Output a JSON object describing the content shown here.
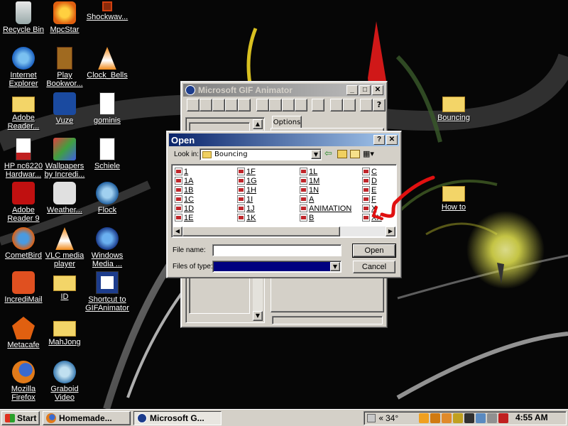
{
  "desktop_icons": [
    {
      "id": "recycle-bin",
      "label": "Recycle Bin",
      "icon": "recycle-bin-icon"
    },
    {
      "id": "mpcstar",
      "label": "MpcStar",
      "icon": "mpcstar-icon"
    },
    {
      "id": "shockwave",
      "label": "Shockwav...",
      "icon": "shockwave-icon"
    },
    {
      "id": "internet-explorer",
      "label": "Internet Explorer",
      "icon": "internet-explorer-icon"
    },
    {
      "id": "play-bookworm",
      "label": "Play Bookwor...",
      "icon": "bookworm-icon"
    },
    {
      "id": "clock-bells",
      "label": "Clock_Bells",
      "icon": "vlc-cone-icon"
    },
    {
      "id": "adobe-reader",
      "label": "Adobe Reader...",
      "icon": "folder-icon"
    },
    {
      "id": "vuze",
      "label": "Vuze",
      "icon": "vuze-icon"
    },
    {
      "id": "gominis",
      "label": "gominis",
      "icon": "document-icon"
    },
    {
      "id": "hp-nc6220",
      "label": "HP nc6220 Hardwar...",
      "icon": "pdf-icon"
    },
    {
      "id": "wallpapers",
      "label": "Wallpapers by Incredi...",
      "icon": "wallpapers-icon"
    },
    {
      "id": "schiele",
      "label": "Schiele",
      "icon": "document-icon"
    },
    {
      "id": "adobe-reader-9",
      "label": "Adobe Reader 9",
      "icon": "adobe-reader-icon"
    },
    {
      "id": "weather",
      "label": "Weather...",
      "icon": "weather-icon"
    },
    {
      "id": "flock",
      "label": "Flock",
      "icon": "flock-icon"
    },
    {
      "id": "cometbird",
      "label": "CometBird",
      "icon": "cometbird-icon"
    },
    {
      "id": "vlc",
      "label": "VLC media player",
      "icon": "vlc-cone-icon"
    },
    {
      "id": "windows-media",
      "label": "Windows Media ...",
      "icon": "windows-media-icon"
    },
    {
      "id": "incredimail",
      "label": "IncrediMail",
      "icon": "incredimail-icon"
    },
    {
      "id": "id",
      "label": "ID",
      "icon": "folder-icon"
    },
    {
      "id": "gifanimator-shortcut",
      "label": "Shortcut to GIFAnimator",
      "icon": "gif-animator-icon"
    },
    {
      "id": "metacafe",
      "label": "Metacafe",
      "icon": "metacafe-icon"
    },
    {
      "id": "mahjong",
      "label": "MahJong",
      "icon": "folder-icon"
    },
    {
      "id": "firefox",
      "label": "Mozilla Firefox",
      "icon": "firefox-icon"
    },
    {
      "id": "graboid",
      "label": "Graboid Video",
      "icon": "graboid-icon"
    },
    {
      "id": "bouncing",
      "label": "Bouncing",
      "icon": "folder-icon"
    },
    {
      "id": "how-to",
      "label": "How to",
      "icon": "folder-icon"
    }
  ],
  "gif_animator": {
    "title": "Microsoft GIF Animator",
    "tab_label": "Options"
  },
  "open_dialog": {
    "title": "Open",
    "help_btn": "?",
    "close_btn": "✕",
    "look_in_label": "Look in:",
    "look_in_value": "Bouncing",
    "files": [
      "1",
      "1A",
      "1B",
      "1C",
      "1D",
      "1E",
      "1F",
      "1G",
      "1H",
      "1I",
      "1J",
      "1K",
      "1L",
      "1M",
      "1N",
      "A",
      "ANIMATION",
      "B",
      "C",
      "D",
      "E",
      "F",
      "X",
      "XX"
    ],
    "file_name_label": "File name:",
    "file_name_value": "",
    "files_of_type_label": "Files of type:",
    "files_of_type_value": "",
    "open_btn": "Open",
    "cancel_btn": "Cancel"
  },
  "taskbar": {
    "start": "Start",
    "tasks": [
      {
        "label": "Homemade...",
        "icon": "firefox-icon",
        "active": false
      },
      {
        "label": "Microsoft G...",
        "icon": "gif-animator-icon",
        "active": true
      }
    ],
    "temperature": "34°",
    "tray_chevron": "«",
    "clock": "4:55 AM"
  },
  "colors": {
    "window_face": "#d4d0c8",
    "active_title": "#0a246a",
    "annotation_arrow": "#e01010",
    "files_of_type_fill": "#000080"
  }
}
